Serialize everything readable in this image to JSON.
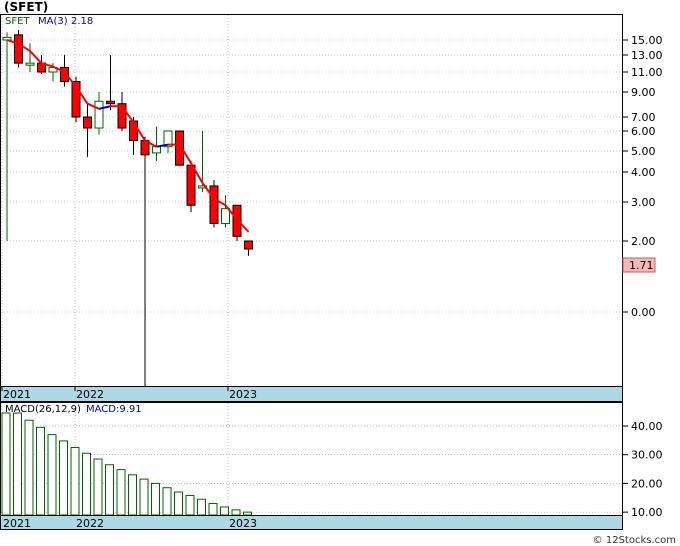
{
  "title": "(SFET)",
  "credit": "© 12Stocks.com",
  "colors": {
    "up_candle": "#006400",
    "down_candle": "#ff0000",
    "ma_rising": "#0000cc",
    "ma_falling": "#ff0000",
    "macd_bar": "#006400",
    "axis_strip": "#add8e6",
    "grid": "#999999",
    "last_price_box": "#f4b8b8"
  },
  "chart_data": [
    {
      "type": "candlestick",
      "scale": "log",
      "legend": {
        "symbol": "SFET",
        "ma_label": "MA(3)",
        "ma_value": "2.18"
      },
      "y_ticks": [
        "15.00",
        "13.00",
        "11.00",
        "9.00",
        "7.00",
        "6.00",
        "5.00",
        "4.00",
        "3.00",
        "2.00",
        "0.00"
      ],
      "x_tick_labels": [
        "2021",
        "2022",
        "2023"
      ],
      "last_price_label": "1.71",
      "candles": [
        {
          "o": 15.0,
          "h": 16.5,
          "l": 2.0,
          "c": 15.5
        },
        {
          "o": 16.0,
          "h": 17.0,
          "l": 11.5,
          "c": 12.0
        },
        {
          "o": 12.0,
          "h": 14.5,
          "l": 11.0,
          "c": 12.0
        },
        {
          "o": 12.0,
          "h": 13.0,
          "l": 10.8,
          "c": 11.0
        },
        {
          "o": 11.0,
          "h": 12.0,
          "l": 10.0,
          "c": 11.5
        },
        {
          "o": 11.5,
          "h": 13.0,
          "l": 9.5,
          "c": 10.0
        },
        {
          "o": 10.0,
          "h": 10.5,
          "l": 6.6,
          "c": 7.0
        },
        {
          "o": 7.0,
          "h": 8.0,
          "l": 4.7,
          "c": 6.2
        },
        {
          "o": 6.2,
          "h": 9.0,
          "l": 5.8,
          "c": 8.2
        },
        {
          "o": 8.2,
          "h": 13.0,
          "l": 7.5,
          "c": 8.0
        },
        {
          "o": 8.0,
          "h": 9.0,
          "l": 6.0,
          "c": 6.2
        },
        {
          "o": 6.7,
          "h": 7.0,
          "l": 4.8,
          "c": 5.5
        },
        {
          "o": 5.5,
          "h": 5.7,
          "l": 0.0,
          "c": 4.8
        },
        {
          "o": 4.9,
          "h": 6.3,
          "l": 4.5,
          "c": 5.2
        },
        {
          "o": 5.2,
          "h": 6.0,
          "l": 4.9,
          "c": 6.0
        },
        {
          "o": 6.0,
          "h": 6.0,
          "l": 4.3,
          "c": 4.3
        },
        {
          "o": 4.3,
          "h": 4.5,
          "l": 2.7,
          "c": 2.9
        },
        {
          "o": 3.5,
          "h": 6.0,
          "l": 3.3,
          "c": 3.5
        },
        {
          "o": 3.5,
          "h": 3.7,
          "l": 2.3,
          "c": 2.4
        },
        {
          "o": 2.4,
          "h": 3.2,
          "l": 2.3,
          "c": 2.8
        },
        {
          "o": 2.9,
          "h": 2.9,
          "l": 2.0,
          "c": 2.1
        },
        {
          "o": 2.0,
          "h": 2.0,
          "l": 1.5,
          "c": 1.71
        }
      ],
      "ma": [
        15.0,
        14.5,
        13.5,
        12.0,
        11.6,
        11.0,
        9.5,
        8.0,
        7.6,
        7.8,
        7.8,
        6.6,
        5.5,
        5.2,
        5.3,
        5.3,
        4.4,
        3.6,
        3.1,
        2.9,
        2.5,
        2.2
      ]
    },
    {
      "type": "bar",
      "legend": {
        "label": "MACD(26,12,9)",
        "value_label": "MACD:9.91"
      },
      "y_ticks": [
        "40.00",
        "30.00",
        "20.00",
        "10.00"
      ],
      "ylim": [
        9,
        48
      ],
      "x_tick_labels": [
        "2021",
        "2022",
        "2023"
      ],
      "values": [
        47.0,
        44.5,
        42.0,
        39.5,
        37.0,
        34.8,
        32.5,
        30.5,
        28.5,
        26.5,
        24.8,
        23.0,
        21.5,
        20.0,
        18.5,
        17.0,
        15.8,
        14.5,
        13.0,
        11.8,
        10.8,
        10.0
      ]
    }
  ]
}
